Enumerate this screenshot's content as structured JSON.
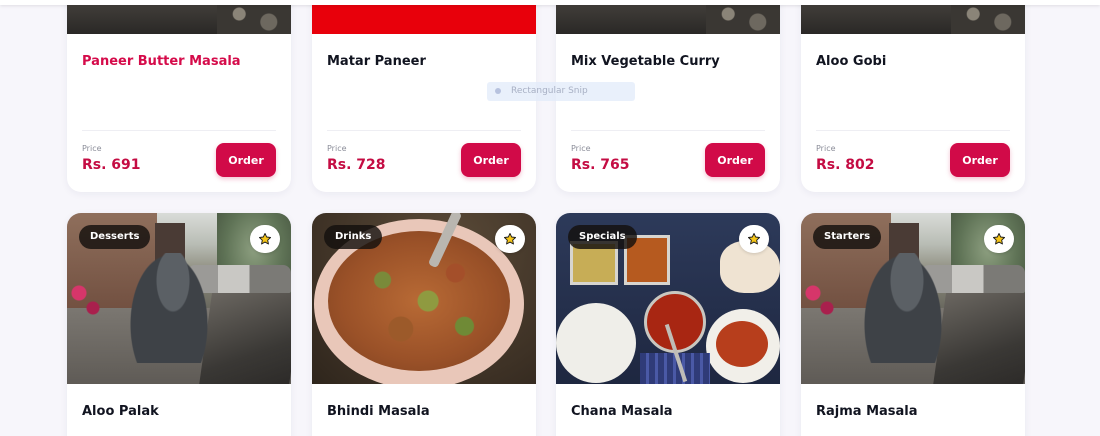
{
  "row1": [
    {
      "title": "Paneer Butter Masala",
      "price_label": "Price",
      "price": "Rs. 691",
      "order_label": "Order",
      "highlighted": true
    },
    {
      "title": "Matar Paneer",
      "price_label": "Price",
      "price": "Rs. 728",
      "order_label": "Order"
    },
    {
      "title": "Mix Vegetable Curry",
      "price_label": "Price",
      "price": "Rs. 765",
      "order_label": "Order"
    },
    {
      "title": "Aloo Gobi",
      "price_label": "Price",
      "price": "Rs. 802",
      "order_label": "Order"
    }
  ],
  "row2": [
    {
      "title": "Aloo Palak",
      "badge": "Desserts",
      "favorite_icon": "star-icon"
    },
    {
      "title": "Bhindi Masala",
      "badge": "Drinks",
      "favorite_icon": "star-icon"
    },
    {
      "title": "Chana Masala",
      "badge": "Specials",
      "favorite_icon": "star-icon"
    },
    {
      "title": "Rajma Masala",
      "badge": "Starters",
      "favorite_icon": "star-icon"
    }
  ],
  "overlay": {
    "snip_label": "Rectangular Snip"
  },
  "colors": {
    "accent": "#d10a48",
    "price": "#c40c43",
    "background": "#f7f6fb",
    "star": "#f5c518"
  }
}
